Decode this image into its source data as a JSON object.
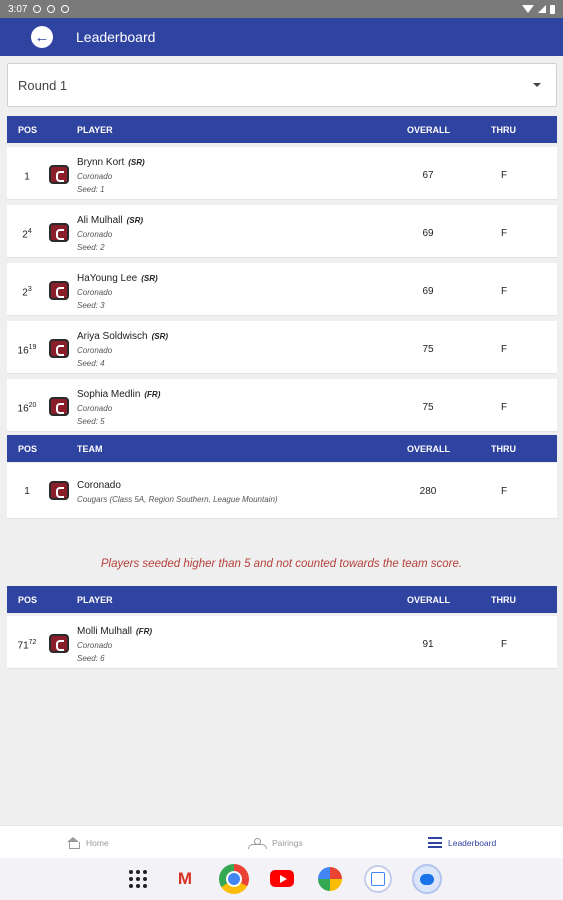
{
  "status_bar": {
    "time": "3:07"
  },
  "app_bar": {
    "back_icon": "arrow-left-icon",
    "title": "Leaderboard"
  },
  "round_select": {
    "value": "Round 1"
  },
  "player_table_headers": {
    "pos": "POS",
    "name": "PLAYER",
    "overall": "OVERALL",
    "thru": "THRU"
  },
  "players": [
    {
      "pos": "1",
      "pos_sup": "",
      "name": "Brynn Kort",
      "class": "(SR)",
      "school": "Coronado",
      "seed": "Seed: 1",
      "overall": "67",
      "thru": "F"
    },
    {
      "pos": "2",
      "pos_sup": "4",
      "name": "Ali Mulhall",
      "class": "(SR)",
      "school": "Coronado",
      "seed": "Seed: 2",
      "overall": "69",
      "thru": "F"
    },
    {
      "pos": "2",
      "pos_sup": "3",
      "name": "HaYoung Lee",
      "class": "(SR)",
      "school": "Coronado",
      "seed": "Seed: 3",
      "overall": "69",
      "thru": "F"
    },
    {
      "pos": "16",
      "pos_sup": "19",
      "name": "Ariya Soldwisch",
      "class": "(SR)",
      "school": "Coronado",
      "seed": "Seed: 4",
      "overall": "75",
      "thru": "F"
    },
    {
      "pos": "16",
      "pos_sup": "20",
      "name": "Sophia Medlin",
      "class": "(FR)",
      "school": "Coronado",
      "seed": "Seed: 5",
      "overall": "75",
      "thru": "F"
    }
  ],
  "team_table_headers": {
    "pos": "POS",
    "name": "TEAM",
    "overall": "OVERALL",
    "thru": "THRU"
  },
  "team": {
    "pos": "1",
    "name": "Coronado",
    "details": "Cougars (Class 5A, Region Southern, League Mountain)",
    "overall": "280",
    "thru": "F"
  },
  "note": "Players seeded higher than 5 and not counted towards the team score.",
  "extra_table_headers": {
    "pos": "POS",
    "name": "PLAYER",
    "overall": "OVERALL",
    "thru": "THRU"
  },
  "extra_players": [
    {
      "pos": "71",
      "pos_sup": "72",
      "name": "Molli Mulhall",
      "class": "(FR)",
      "school": "Coronado",
      "seed": "Seed: 6",
      "overall": "91",
      "thru": "F"
    }
  ],
  "bottom_nav": [
    {
      "label": "Home",
      "icon": "home-icon"
    },
    {
      "label": "Pairings",
      "icon": "pairings-icon"
    },
    {
      "label": "Leaderboard",
      "icon": "leaderboard-icon",
      "active": true
    }
  ],
  "colors": {
    "primary": "#2f43a1",
    "note": "#b6403a"
  }
}
